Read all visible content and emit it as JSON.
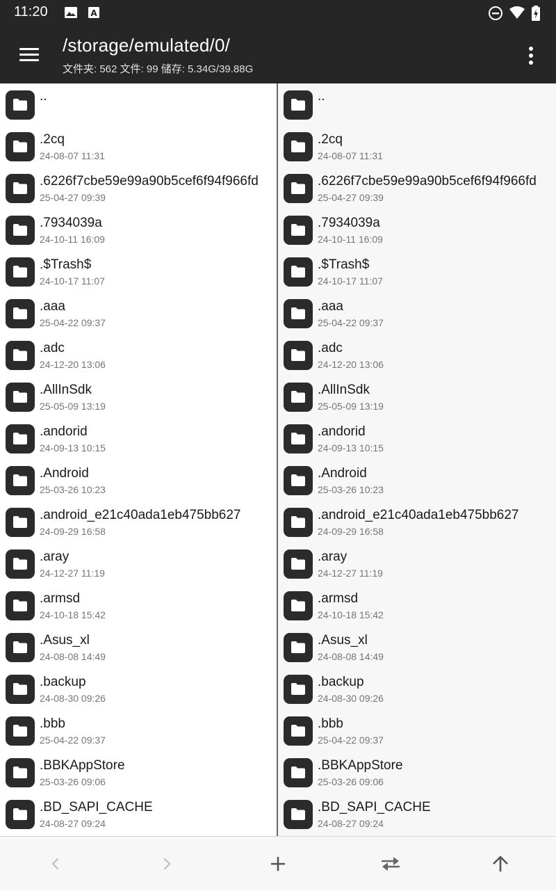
{
  "status_bar": {
    "time": "11:20",
    "left_icons": [
      "image-icon",
      "a-icon"
    ],
    "right_icons": [
      "do-not-disturb-icon",
      "wifi-icon",
      "battery-icon"
    ]
  },
  "app_bar": {
    "menu_icon": "hamburger-menu-icon",
    "path": "/storage/emulated/0/",
    "stats": "文件夹: 562  文件: 99  储存: 5.34G/39.88G",
    "overflow_icon": "more-vert-icon"
  },
  "colors": {
    "bar_background": "#262626",
    "folder_icon": "#2b2b2b",
    "right_pane_background": "#f7f7f7"
  },
  "panes": [
    {
      "id": "left",
      "items": [
        {
          "name": "..",
          "date": ""
        },
        {
          "name": ".2cq",
          "date": "24-08-07 11:31"
        },
        {
          "name": ".6226f7cbe59e99a90b5cef6f94f966fd",
          "date": "25-04-27 09:39"
        },
        {
          "name": ".7934039a",
          "date": "24-10-11 16:09"
        },
        {
          "name": ".$Trash$",
          "date": "24-10-17 11:07"
        },
        {
          "name": ".aaa",
          "date": "25-04-22 09:37"
        },
        {
          "name": ".adc",
          "date": "24-12-20 13:06"
        },
        {
          "name": ".AllInSdk",
          "date": "25-05-09 13:19"
        },
        {
          "name": ".andorid",
          "date": "24-09-13 10:15"
        },
        {
          "name": ".Android",
          "date": "25-03-26 10:23"
        },
        {
          "name": ".android_e21c40ada1eb475bb627",
          "date": "24-09-29 16:58"
        },
        {
          "name": ".aray",
          "date": "24-12-27 11:19"
        },
        {
          "name": ".armsd",
          "date": "24-10-18 15:42"
        },
        {
          "name": ".Asus_xl",
          "date": "24-08-08 14:49"
        },
        {
          "name": ".backup",
          "date": "24-08-30 09:26"
        },
        {
          "name": ".bbb",
          "date": "25-04-22 09:37"
        },
        {
          "name": ".BBKAppStore",
          "date": "25-03-26 09:06"
        },
        {
          "name": ".BD_SAPI_CACHE",
          "date": "24-08-27 09:24"
        }
      ]
    },
    {
      "id": "right",
      "items": [
        {
          "name": "..",
          "date": ""
        },
        {
          "name": ".2cq",
          "date": "24-08-07 11:31"
        },
        {
          "name": ".6226f7cbe59e99a90b5cef6f94f966fd",
          "date": "25-04-27 09:39"
        },
        {
          "name": ".7934039a",
          "date": "24-10-11 16:09"
        },
        {
          "name": ".$Trash$",
          "date": "24-10-17 11:07"
        },
        {
          "name": ".aaa",
          "date": "25-04-22 09:37"
        },
        {
          "name": ".adc",
          "date": "24-12-20 13:06"
        },
        {
          "name": ".AllInSdk",
          "date": "25-05-09 13:19"
        },
        {
          "name": ".andorid",
          "date": "24-09-13 10:15"
        },
        {
          "name": ".Android",
          "date": "25-03-26 10:23"
        },
        {
          "name": ".android_e21c40ada1eb475bb627",
          "date": "24-09-29 16:58"
        },
        {
          "name": ".aray",
          "date": "24-12-27 11:19"
        },
        {
          "name": ".armsd",
          "date": "24-10-18 15:42"
        },
        {
          "name": ".Asus_xl",
          "date": "24-08-08 14:49"
        },
        {
          "name": ".backup",
          "date": "24-08-30 09:26"
        },
        {
          "name": ".bbb",
          "date": "25-04-22 09:37"
        },
        {
          "name": ".BBKAppStore",
          "date": "25-03-26 09:06"
        },
        {
          "name": ".BD_SAPI_CACHE",
          "date": "24-08-27 09:24"
        }
      ]
    }
  ],
  "bottom_bar": {
    "buttons": [
      "back-icon",
      "forward-icon",
      "add-icon",
      "swap-panes-icon",
      "go-up-icon"
    ]
  }
}
